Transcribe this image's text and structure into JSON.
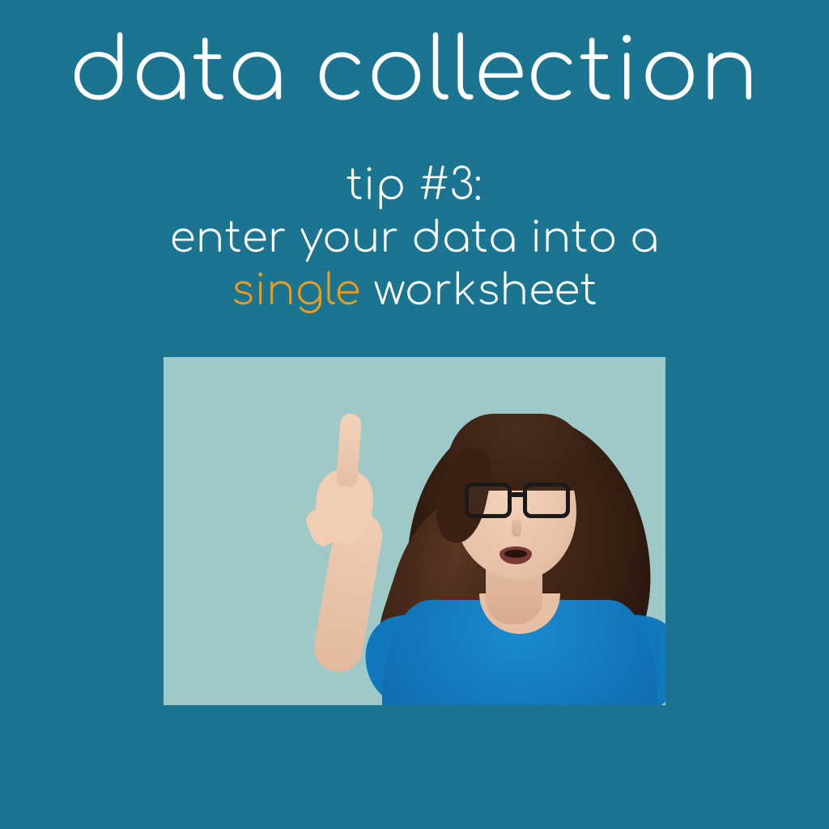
{
  "title": "data collection",
  "tip": {
    "line1": "tip #3:",
    "line2": "enter your data into a",
    "accent": "single",
    "line3_rest": " worksheet"
  },
  "image_alt": "Woman with glasses in a blue shirt pointing upward with her index finger"
}
